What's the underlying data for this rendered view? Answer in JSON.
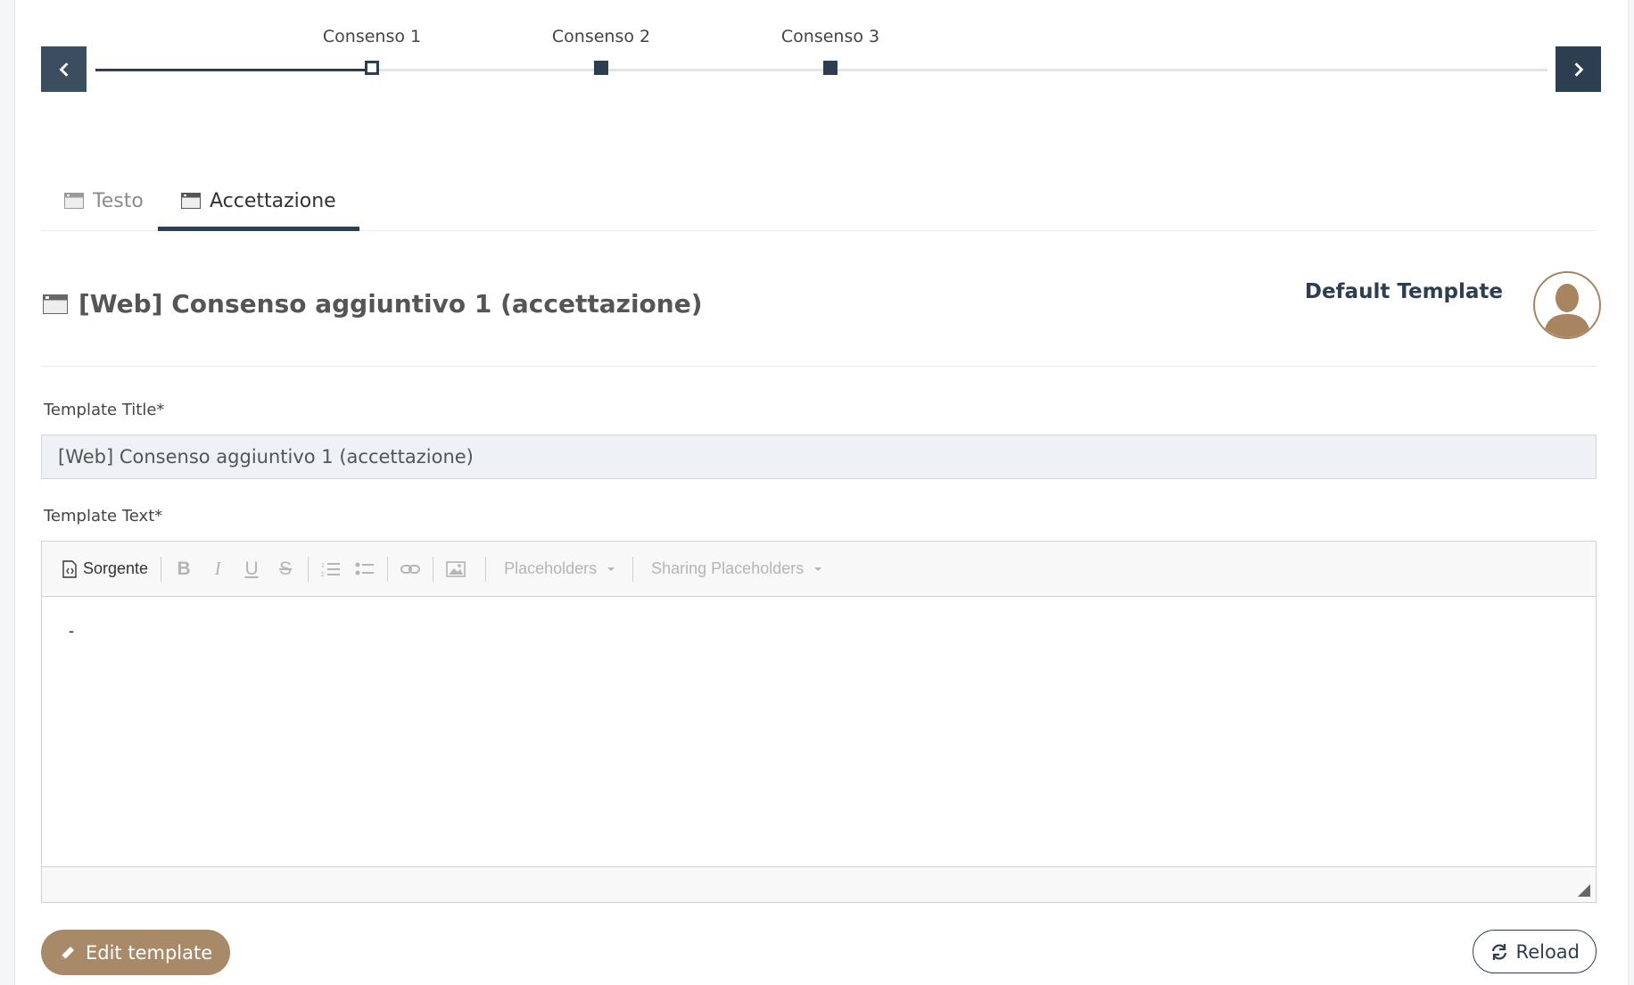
{
  "stepper": {
    "steps": [
      {
        "label": "Consenso 1",
        "state": "current"
      },
      {
        "label": "Consenso 2",
        "state": "pending"
      },
      {
        "label": "Consenso 3",
        "state": "pending"
      }
    ]
  },
  "tabs": [
    {
      "label": "Testo",
      "active": false
    },
    {
      "label": "Accettazione",
      "active": true
    }
  ],
  "header": {
    "title": "[Web] Consenso aggiuntivo 1 (accettazione)",
    "default_label": "Default Template"
  },
  "form": {
    "title_label": "Template Title*",
    "title_value": "[Web] Consenso aggiuntivo 1 (accettazione)",
    "text_label": "Template Text*",
    "toolbar": {
      "source_label": "Sorgente",
      "placeholders_label": "Placeholders",
      "sharing_placeholders_label": "Sharing Placeholders"
    },
    "editor_content": "-"
  },
  "actions": {
    "edit_label": "Edit template",
    "reload_label": "Reload"
  },
  "colors": {
    "primary": "#2c3e50",
    "accent": "#a88a68"
  }
}
